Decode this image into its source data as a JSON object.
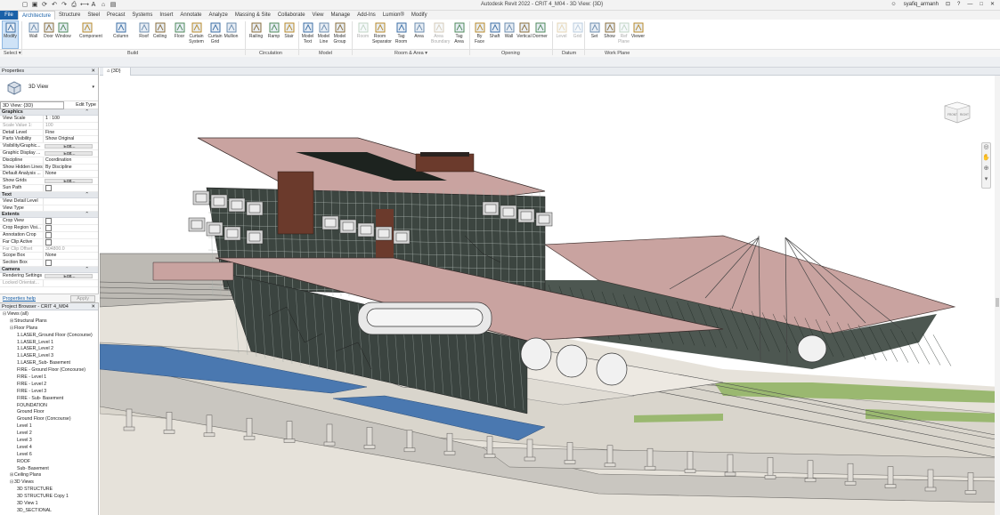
{
  "window": {
    "title": "Autodesk Revit 2022 - CRIT 4_M04 - 3D View: {3D}",
    "user": "syafiq_armanh",
    "quick_access_icons": [
      "open-icon",
      "save-icon",
      "sync-icon",
      "undo-icon",
      "redo-icon",
      "print-icon",
      "measure-icon",
      "text-icon",
      "3d-view-icon",
      "switch-windows-icon"
    ]
  },
  "menu": {
    "file": "File",
    "tabs": [
      "Architecture",
      "Structure",
      "Steel",
      "Precast",
      "Systems",
      "Insert",
      "Annotate",
      "Analyze",
      "Massing & Site",
      "Collaborate",
      "View",
      "Manage",
      "Add-Ins",
      "Lumion®",
      "Modify"
    ],
    "active_tab": "Architecture"
  },
  "ribbon": {
    "tools": [
      {
        "label": "Modify",
        "icon": "pointer-icon"
      },
      {
        "label": "Wall",
        "icon": "wall-icon"
      },
      {
        "label": "Door",
        "icon": "door-icon"
      },
      {
        "label": "Window",
        "icon": "window-icon"
      },
      {
        "label": "Component",
        "icon": "component-icon"
      },
      {
        "label": "Column",
        "icon": "column-icon"
      },
      {
        "label": "Roof",
        "icon": "roof-icon"
      },
      {
        "label": "Ceiling",
        "icon": "ceiling-icon"
      },
      {
        "label": "Floor",
        "icon": "floor-icon"
      },
      {
        "label": "Curtain System",
        "icon": "curtain-system-icon"
      },
      {
        "label": "Curtain Grid",
        "icon": "curtain-grid-icon"
      },
      {
        "label": "Mullion",
        "icon": "mullion-icon"
      },
      {
        "label": "Railing",
        "icon": "railing-icon"
      },
      {
        "label": "Ramp",
        "icon": "ramp-icon"
      },
      {
        "label": "Stair",
        "icon": "stair-icon"
      },
      {
        "label": "Model Text",
        "icon": "model-text-icon"
      },
      {
        "label": "Model Line",
        "icon": "model-line-icon"
      },
      {
        "label": "Model Group",
        "icon": "model-group-icon"
      },
      {
        "label": "Room",
        "icon": "room-icon"
      },
      {
        "label": "Room Separator",
        "icon": "room-separator-icon"
      },
      {
        "label": "Tag Room",
        "icon": "tag-room-icon"
      },
      {
        "label": "Area",
        "icon": "area-icon"
      },
      {
        "label": "Area Boundary",
        "icon": "area-boundary-icon"
      },
      {
        "label": "Tag Area",
        "icon": "tag-area-icon"
      },
      {
        "label": "By Face",
        "icon": "by-face-icon"
      },
      {
        "label": "Shaft",
        "icon": "shaft-icon"
      },
      {
        "label": "Wall",
        "icon": "wall-opening-icon"
      },
      {
        "label": "Vertical",
        "icon": "vertical-opening-icon"
      },
      {
        "label": "Dormer",
        "icon": "dormer-icon"
      },
      {
        "label": "Level",
        "icon": "level-icon"
      },
      {
        "label": "Grid",
        "icon": "grid-icon"
      },
      {
        "label": "Set",
        "icon": "set-workplane-icon"
      },
      {
        "label": "Show",
        "icon": "show-workplane-icon"
      },
      {
        "label": "Ref Plane",
        "icon": "ref-plane-icon"
      },
      {
        "label": "Viewer",
        "icon": "viewer-icon"
      }
    ],
    "panels": [
      "Select ▾",
      "Build",
      "Circulation",
      "Model",
      "Room & Area ▾",
      "Opening",
      "Datum",
      "Work Plane"
    ]
  },
  "properties": {
    "title": "Properties",
    "type_name": "3D View",
    "view_selector": "3D View: {3D}",
    "edit_type": "Edit Type",
    "categories": [
      {
        "name": "Graphics",
        "rows": [
          {
            "key": "View Scale",
            "value": "1 : 100"
          },
          {
            "key": "Scale Value  1:",
            "value": "100",
            "dim": true
          },
          {
            "key": "Detail Level",
            "value": "Fine"
          },
          {
            "key": "Parts Visibility",
            "value": "Show Original"
          },
          {
            "key": "Visibility/Graphic...",
            "value": "Edit...",
            "button": true
          },
          {
            "key": "Graphic Display ...",
            "value": "Edit...",
            "button": true
          },
          {
            "key": "Discipline",
            "value": "Coordination"
          },
          {
            "key": "Show Hidden Lines",
            "value": "By Discipline"
          },
          {
            "key": "Default Analysis ...",
            "value": "None"
          },
          {
            "key": "Show Grids",
            "value": "Edit...",
            "button": true
          },
          {
            "key": "Sun Path",
            "value": "",
            "checkbox": true
          }
        ]
      },
      {
        "name": "Text",
        "rows": [
          {
            "key": "View Detail Level",
            "value": ""
          },
          {
            "key": "View Type",
            "value": ""
          }
        ]
      },
      {
        "name": "Extents",
        "rows": [
          {
            "key": "Crop View",
            "value": "",
            "checkbox": true
          },
          {
            "key": "Crop Region Visi...",
            "value": "",
            "checkbox": true
          },
          {
            "key": "Annotation Crop",
            "value": "",
            "checkbox": true
          },
          {
            "key": "Far Clip Active",
            "value": "",
            "checkbox": true
          },
          {
            "key": "Far Clip Offset",
            "value": "304800.0",
            "dim": true
          },
          {
            "key": "Scope Box",
            "value": "None"
          },
          {
            "key": "Section Box",
            "value": "",
            "checkbox": true
          }
        ]
      },
      {
        "name": "Camera",
        "rows": [
          {
            "key": "Rendering Settings",
            "value": "Edit...",
            "button": true
          },
          {
            "key": "Locked Orientat...",
            "value": "",
            "dim": true
          }
        ]
      }
    ],
    "help_link": "Properties help",
    "apply": "Apply"
  },
  "browser": {
    "title": "Project Browser - CRIT 4_M04",
    "items": [
      {
        "label": "Views (all)",
        "level": 0,
        "toggle": "⊟"
      },
      {
        "label": "Structural Plans",
        "level": 1,
        "toggle": "⊞"
      },
      {
        "label": "Floor Plans",
        "level": 1,
        "toggle": "⊟"
      },
      {
        "label": "1.LASER_Ground Floor (Concourse)",
        "level": 2
      },
      {
        "label": "1.LASER_Level 1",
        "level": 2
      },
      {
        "label": "1.LASER_Level 2",
        "level": 2
      },
      {
        "label": "1.LASER_Level 3",
        "level": 2
      },
      {
        "label": "1.LASER_Sub- Basement",
        "level": 2
      },
      {
        "label": "FIRE - Ground Floor (Concourse)",
        "level": 2
      },
      {
        "label": "FIRE - Level 1",
        "level": 2
      },
      {
        "label": "FIRE - Level 2",
        "level": 2
      },
      {
        "label": "FIRE - Level 3",
        "level": 2
      },
      {
        "label": "FIRE - Sub- Basement",
        "level": 2
      },
      {
        "label": "FOUNDATION",
        "level": 2
      },
      {
        "label": "Ground Floor",
        "level": 2
      },
      {
        "label": "Ground Floor (Concourse)",
        "level": 2
      },
      {
        "label": "Level 1",
        "level": 2
      },
      {
        "label": "Level 2",
        "level": 2
      },
      {
        "label": "Level 3",
        "level": 2
      },
      {
        "label": "Level 4",
        "level": 2
      },
      {
        "label": "Level 6",
        "level": 2
      },
      {
        "label": "ROOF",
        "level": 2
      },
      {
        "label": "Sub- Basement",
        "level": 2
      },
      {
        "label": "Ceiling Plans",
        "level": 1,
        "toggle": "⊞"
      },
      {
        "label": "3D Views",
        "level": 1,
        "toggle": "⊟"
      },
      {
        "label": "3D STRUCTURE",
        "level": 2
      },
      {
        "label": "3D STRUCTURE Copy 1",
        "level": 2
      },
      {
        "label": "3D View 1",
        "level": 2
      },
      {
        "label": "3D_SECTIONAL",
        "level": 2
      }
    ]
  },
  "viewport": {
    "tab_label": "{3D}",
    "viewcube": {
      "left": "FRONT",
      "right": "RIGHT"
    },
    "colors": {
      "roof": "#c9a3a0",
      "glass": "#2e3a33",
      "water": "#4a78b0",
      "ground": "#e2ddd4",
      "grass": "#9ab870",
      "brick": "#6b3a2c"
    }
  }
}
